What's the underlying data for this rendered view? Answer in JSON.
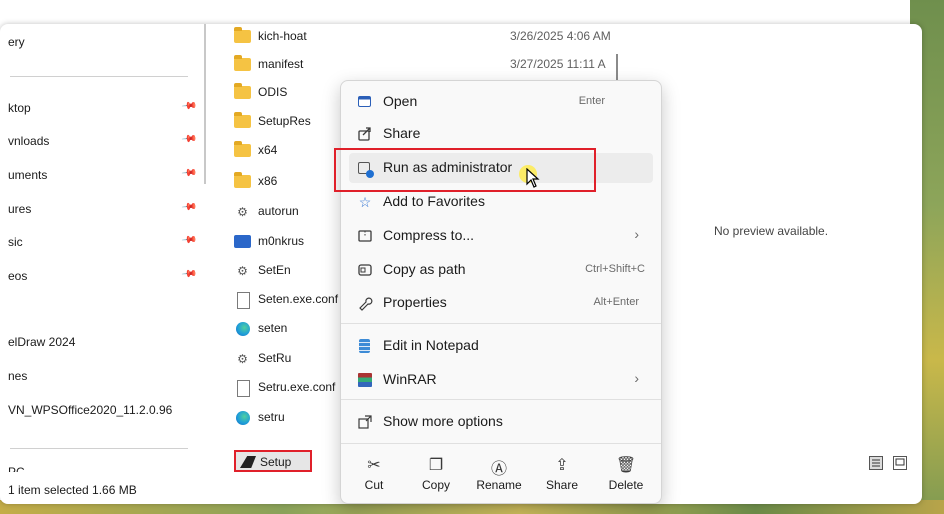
{
  "nav": {
    "items": [
      {
        "label": "ery",
        "pinned": false
      },
      {
        "label": "ktop",
        "pinned": true
      },
      {
        "label": "vnloads",
        "pinned": true
      },
      {
        "label": "uments",
        "pinned": true
      },
      {
        "label": "ures",
        "pinned": true
      },
      {
        "label": "sic",
        "pinned": true
      },
      {
        "label": "eos",
        "pinned": true
      },
      {
        "label": "elDraw 2024",
        "pinned": false
      },
      {
        "label": "nes",
        "pinned": false
      },
      {
        "label": "VN_WPSOffice2020_11.2.0.96",
        "pinned": false
      },
      {
        "label": "PC",
        "pinned": false
      }
    ],
    "pin_glyph": "📌"
  },
  "files": [
    {
      "name": "kich-hoat",
      "date": "3/26/2025 4:06 AM",
      "icon": "folder-icon"
    },
    {
      "name": "manifest",
      "date": "3/27/2025 11:11 A",
      "icon": "folder-icon"
    },
    {
      "name": "ODIS",
      "date": "",
      "icon": "folder-icon"
    },
    {
      "name": "SetupRes",
      "date": "",
      "icon": "folder-icon"
    },
    {
      "name": "x64",
      "date": "",
      "icon": "folder-icon"
    },
    {
      "name": "x86",
      "date": "",
      "icon": "folder-icon"
    },
    {
      "name": "autorun",
      "date": "",
      "icon": "settings-file-icon"
    },
    {
      "name": "m0nkrus",
      "date": "",
      "icon": "image-file-icon"
    },
    {
      "name": "SetEn",
      "date": "",
      "icon": "gear-file-icon"
    },
    {
      "name": "Seten.exe.conf",
      "date": "",
      "icon": "blank-file-icon"
    },
    {
      "name": "seten",
      "date": "",
      "icon": "edge-icon"
    },
    {
      "name": "SetRu",
      "date": "",
      "icon": "gear-file-icon"
    },
    {
      "name": "Setru.exe.conf",
      "date": "",
      "icon": "blank-file-icon"
    },
    {
      "name": "setru",
      "date": "",
      "icon": "edge-icon"
    },
    {
      "name": "Setup",
      "date": "",
      "icon": "setup-app-icon"
    }
  ],
  "status": {
    "text": "1 item selected  1.66 MB"
  },
  "preview": {
    "text": "No preview available."
  },
  "context_menu": {
    "items": [
      {
        "label": "Open",
        "shortcut": "Enter",
        "icon": "open-icon"
      },
      {
        "label": "Share",
        "shortcut": "",
        "icon": "share-icon"
      },
      {
        "label": "Run as administrator",
        "shortcut": "",
        "icon": "run-as-admin-icon"
      },
      {
        "label": "Add to Favorites",
        "shortcut": "",
        "icon": "star-icon"
      },
      {
        "label": "Compress to...",
        "shortcut": "",
        "icon": "compress-icon",
        "submenu": true
      },
      {
        "label": "Copy as path",
        "shortcut": "Ctrl+Shift+C",
        "icon": "copy-path-icon"
      },
      {
        "label": "Properties",
        "shortcut": "Alt+Enter",
        "icon": "wrench-icon"
      },
      {
        "label": "Edit in Notepad",
        "shortcut": "",
        "icon": "notepad-icon"
      },
      {
        "label": "WinRAR",
        "shortcut": "",
        "icon": "winrar-icon",
        "submenu": true
      },
      {
        "label": "Show more options",
        "shortcut": "",
        "icon": "more-options-icon"
      }
    ],
    "quick_actions": [
      {
        "label": "Cut",
        "icon": "cut-icon"
      },
      {
        "label": "Copy",
        "icon": "copy-icon"
      },
      {
        "label": "Rename",
        "icon": "rename-icon"
      },
      {
        "label": "Share",
        "icon": "share-icon"
      },
      {
        "label": "Delete",
        "icon": "trash-icon"
      }
    ],
    "submenu_arrow": "›",
    "hovered": "Run as administrator"
  },
  "colors": {
    "highlight_box": "#e0202a",
    "cursor_glow": "#ffec50"
  }
}
